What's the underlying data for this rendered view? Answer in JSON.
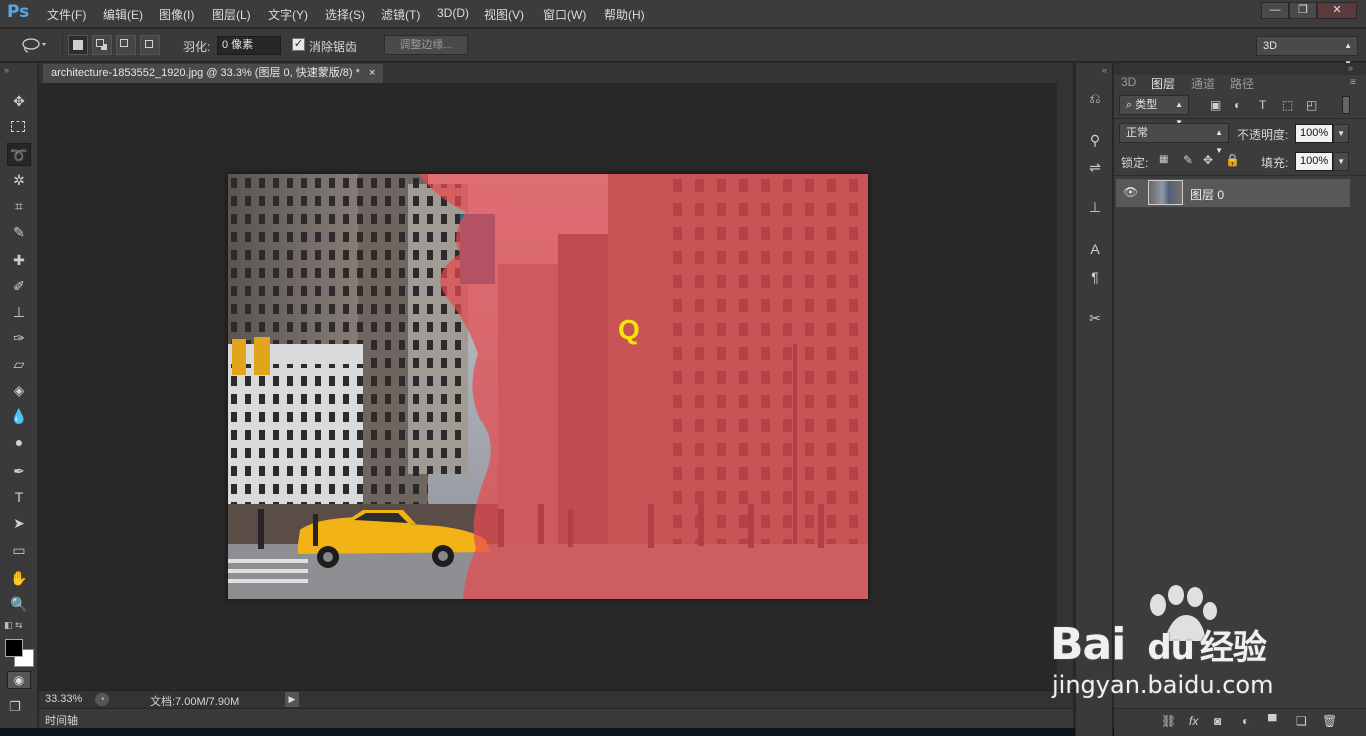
{
  "app": {
    "logo": "Ps"
  },
  "menu": {
    "items": [
      "文件(F)",
      "编辑(E)",
      "图像(I)",
      "图层(L)",
      "文字(Y)",
      "选择(S)",
      "滤镜(T)",
      "3D(D)",
      "视图(V)",
      "窗口(W)",
      "帮助(H)"
    ]
  },
  "window_controls": {
    "minimize": "—",
    "restore": "❐",
    "close": "✕"
  },
  "options": {
    "feather_label": "羽化:",
    "feather_value": "0 像素",
    "antialias_label": "消除锯齿",
    "antialias_checked": "✓",
    "refine_edge_label": "调整边缘...",
    "workspace_value": "3D"
  },
  "document": {
    "tab_title": "architecture-1853552_1920.jpg @ 33.3% (图层 0, 快速蒙版/8) *",
    "close": "×"
  },
  "canvas": {
    "overlay_letter": "Q",
    "mask_color": "#e84a4f"
  },
  "status": {
    "zoom": "33.33%",
    "doc_size": "文档:7.00M/7.90M"
  },
  "timeline": {
    "label": "时间轴"
  },
  "panel": {
    "tabs": [
      "3D",
      "图层",
      "通道",
      "路径"
    ],
    "filter_label": "类型",
    "blend_mode": "正常",
    "opacity_label": "不透明度:",
    "opacity_value": "100%",
    "lock_label": "锁定:",
    "fill_label": "填充:",
    "fill_value": "100%",
    "layers": [
      {
        "name": "图层 0",
        "visible": true
      }
    ]
  },
  "watermark": {
    "brand": "Bai",
    "brand2": "du",
    "cn": "经验",
    "url": "jingyan.baidu.com"
  }
}
